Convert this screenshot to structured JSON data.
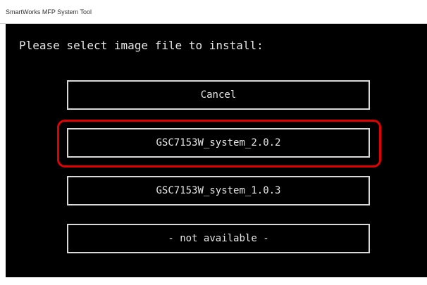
{
  "window": {
    "title": "SmartWorks MFP System Tool"
  },
  "console": {
    "prompt": "Please select image file to install:",
    "options": [
      {
        "label": "Cancel"
      },
      {
        "label": "GSC7153W_system_2.0.2"
      },
      {
        "label": "GSC7153W_system_1.0.3"
      },
      {
        "label": "- not available -"
      }
    ]
  },
  "annotation": {
    "highlight_color": "#e00000"
  }
}
